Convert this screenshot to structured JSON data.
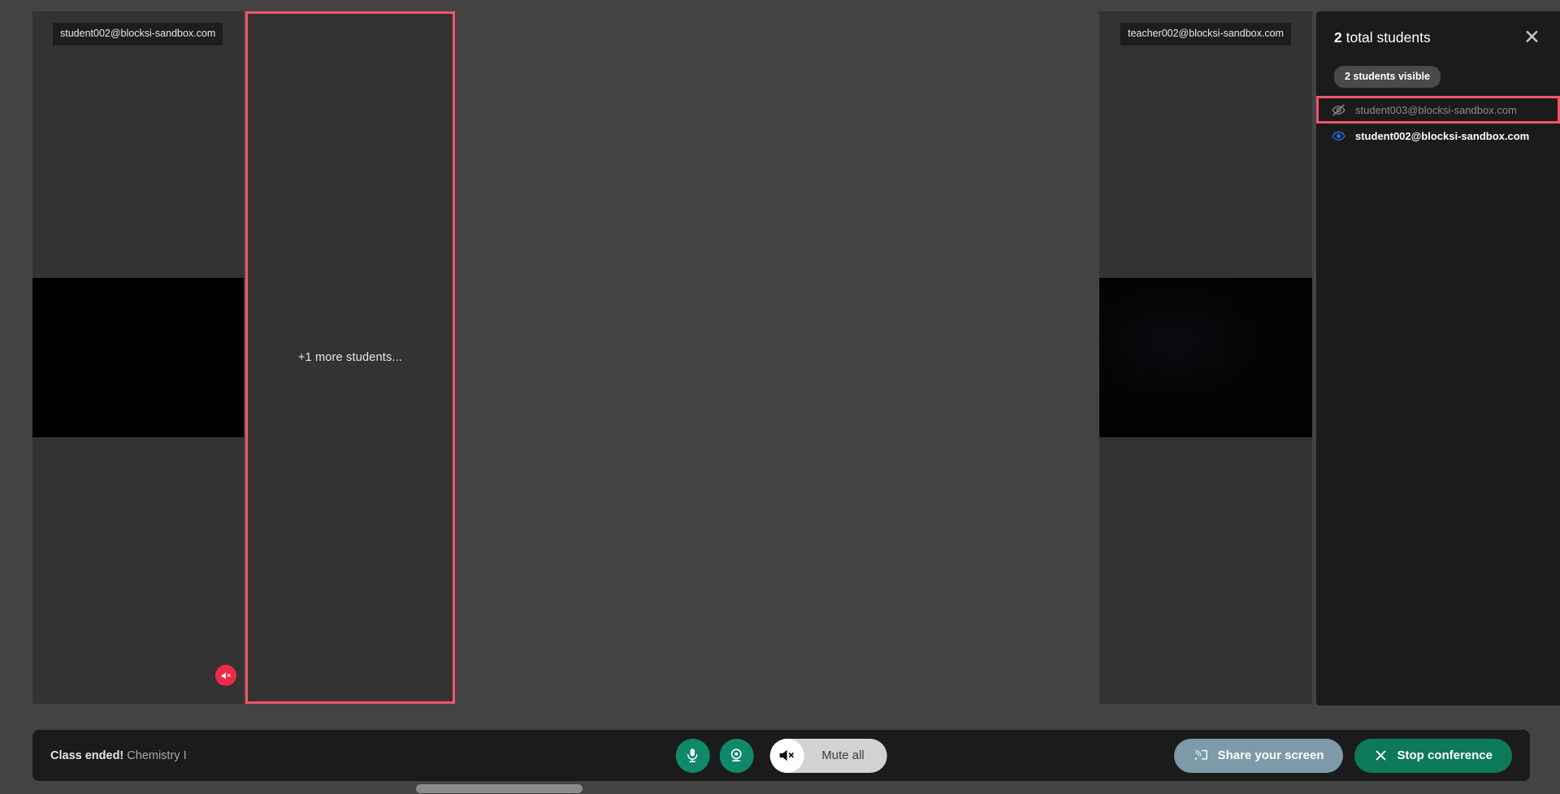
{
  "stage": {
    "tiles": [
      {
        "id": "student002-tile",
        "label": "student002@blocksi-sandbox.com",
        "highlighted": false,
        "muted_badge": true,
        "placeholder_text": ""
      },
      {
        "id": "more-students-tile",
        "label": "",
        "highlighted": true,
        "muted_badge": false,
        "placeholder_text": "+1 more students..."
      },
      {
        "id": "teacher002-tile",
        "label": "teacher002@blocksi-sandbox.com",
        "highlighted": false,
        "muted_badge": false,
        "placeholder_text": ""
      }
    ]
  },
  "sidebar": {
    "title_count": "2",
    "title_rest": " total students",
    "close_label": "✕",
    "visible_chip": "2 students visible",
    "students": [
      {
        "email": "student003@blocksi-sandbox.com",
        "visibility": "hidden",
        "icon": "eye-off-icon",
        "highlighted": true
      },
      {
        "email": "student002@blocksi-sandbox.com",
        "visibility": "visible",
        "icon": "eye-icon",
        "highlighted": false
      }
    ]
  },
  "bottombar": {
    "status_bold": "Class ended!",
    "status_subject": "Chemistry I",
    "mic_icon": "microphone-icon",
    "camera_icon": "webcam-icon",
    "mute_all_label": "Mute all",
    "mute_all_icon": "speaker-muted-icon",
    "share_label": "Share your screen",
    "share_icon": "screencast-icon",
    "stop_label": "Stop conference",
    "stop_icon": "close-x-icon"
  },
  "colors": {
    "accent_green": "#10896a",
    "stop_green": "#0c7a59",
    "share_blue_gray": "#7d9aa8",
    "highlight_red": "#f4566a",
    "mute_badge_red": "#ee2b46",
    "eye_blue": "#2b62e8",
    "panel_dark": "#1b1b1b",
    "tile_gray": "#333333",
    "page_gray": "#434343"
  }
}
